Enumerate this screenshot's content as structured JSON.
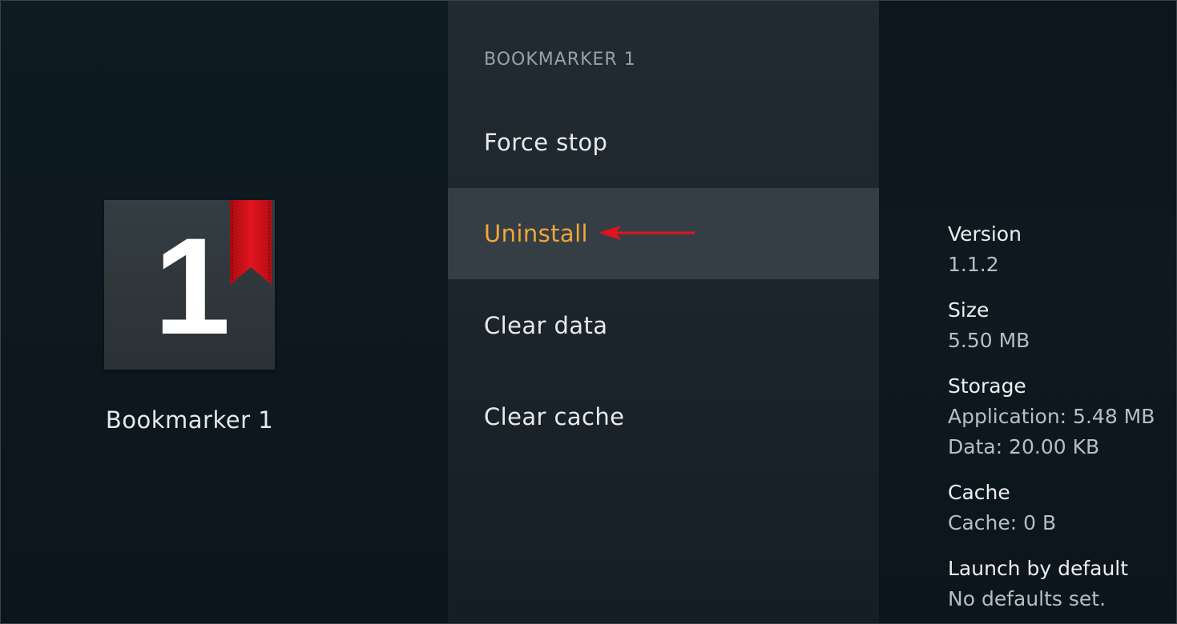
{
  "app": {
    "name": "Bookmarker 1",
    "icon_digit": "1",
    "icon_semantic": "bookmarker-app-icon",
    "ribbon_color": "#d0101a"
  },
  "menu": {
    "header": "BOOKMARKER 1",
    "items": [
      {
        "label": "Force stop"
      },
      {
        "label": "Uninstall",
        "selected": true
      },
      {
        "label": "Clear data"
      },
      {
        "label": "Clear cache"
      }
    ],
    "selected_color": "#f0a63a"
  },
  "annotation": {
    "arrow_color": "#e0141e",
    "arrow_icon": "left-arrow-icon"
  },
  "info": {
    "version": {
      "label": "Version",
      "value": "1.1.2"
    },
    "size": {
      "label": "Size",
      "value": "5.50 MB"
    },
    "storage": {
      "label": "Storage",
      "application": "Application: 5.48 MB",
      "data": "Data: 20.00 KB"
    },
    "cache": {
      "label": "Cache",
      "value": "Cache: 0 B"
    },
    "launch": {
      "label": "Launch by default",
      "value": "No defaults set."
    }
  }
}
